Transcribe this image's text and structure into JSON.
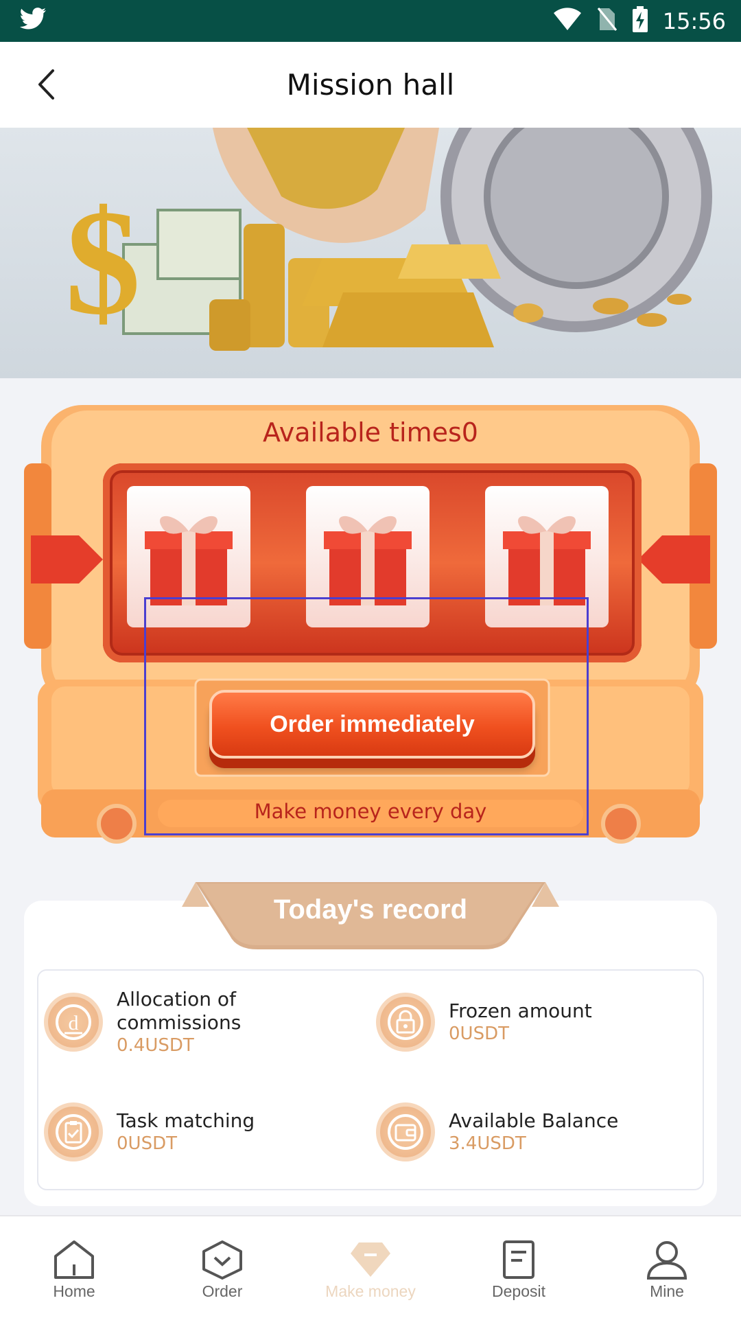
{
  "status_bar": {
    "time": "15:56",
    "icons": [
      "twitter-icon",
      "wifi-icon",
      "no-sim-icon",
      "battery-charging-icon"
    ]
  },
  "header": {
    "title": "Mission hall",
    "back_icon": "chevron-left-icon"
  },
  "slot_machine": {
    "available_times": "Available times0",
    "order_button": "Order immediately",
    "tagline": "Make money every day",
    "reels": [
      "gift-icon",
      "gift-icon",
      "gift-icon"
    ]
  },
  "todays_record": {
    "title": "Today's record",
    "stats": [
      {
        "label": "Allocation of commissions",
        "value": "0.4USDT",
        "icon": "coin-d-icon"
      },
      {
        "label": "Frozen amount",
        "value": "0USDT",
        "icon": "lock-icon"
      },
      {
        "label": "Task matching",
        "value": "0USDT",
        "icon": "clipboard-check-icon"
      },
      {
        "label": "Available Balance",
        "value": "3.4USDT",
        "icon": "wallet-icon"
      }
    ]
  },
  "bottom_nav": {
    "items": [
      {
        "label": "Home",
        "icon": "home-icon"
      },
      {
        "label": "Order",
        "icon": "order-icon"
      },
      {
        "label": "Make money",
        "icon": "diamond-icon",
        "active": true
      },
      {
        "label": "Deposit",
        "icon": "document-icon"
      },
      {
        "label": "Mine",
        "icon": "user-icon"
      }
    ]
  },
  "colors": {
    "status_bar": "#075046",
    "accent_red": "#b8241c",
    "accent_orange": "#f0501f",
    "value_gold": "#d99b63",
    "nav_active": "#ecd6bf"
  }
}
